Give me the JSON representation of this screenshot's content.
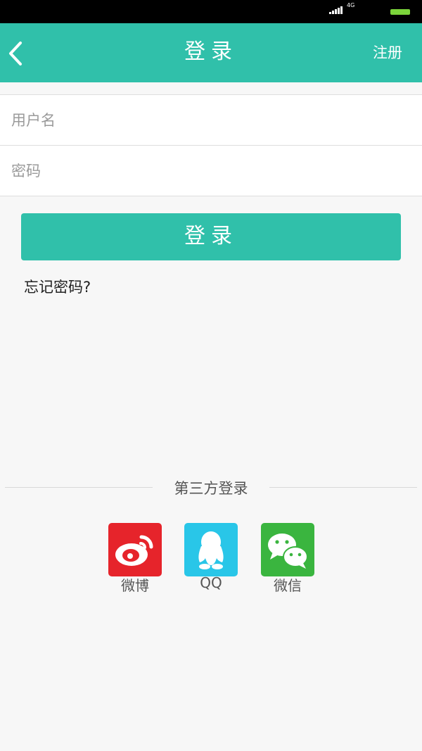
{
  "status_bar": {
    "network": "4G"
  },
  "header": {
    "back_icon": "chevron-left-icon",
    "title": "登录",
    "register": "注册"
  },
  "form": {
    "username_placeholder": "用户名",
    "password_placeholder": "密码"
  },
  "actions": {
    "login": "登录",
    "forgot_password": "忘记密码?"
  },
  "third_party": {
    "title": "第三方登录",
    "providers": [
      {
        "label": "微博",
        "icon": "weibo-icon",
        "color": "#e6242b"
      },
      {
        "label": "QQ",
        "icon": "qq-icon",
        "color": "#29c6e8"
      },
      {
        "label": "微信",
        "icon": "wechat-icon",
        "color": "#3ab53f"
      }
    ]
  },
  "colors": {
    "accent": "#30c0aa",
    "background": "#f7f7f7",
    "battery": "#7bd43b"
  }
}
